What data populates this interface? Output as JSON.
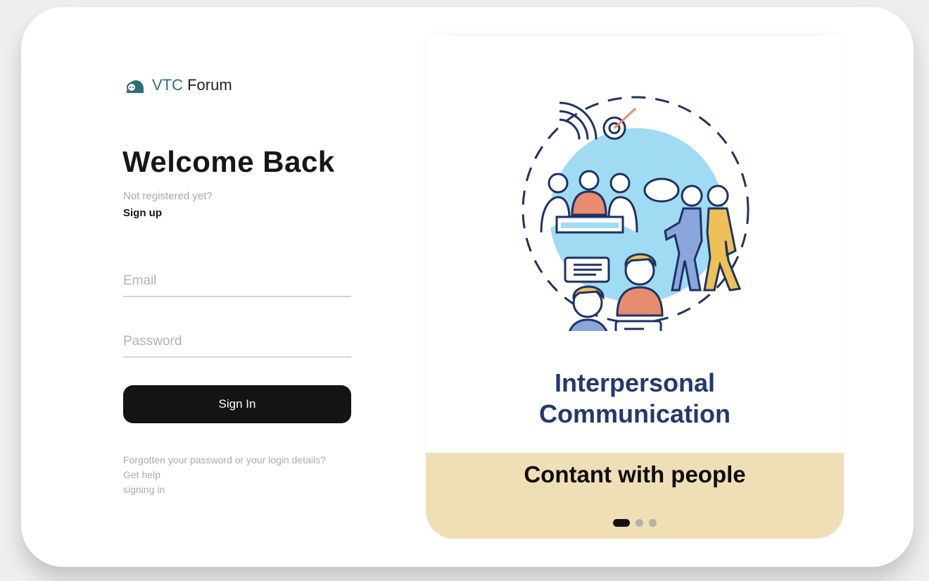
{
  "brand": {
    "name_accent": "VTC",
    "name_rest": " Forum",
    "icon": "chat-helmet-icon"
  },
  "login": {
    "heading": "Welcome Back",
    "not_registered": "Not registered yet?",
    "signup_label": "Sign up",
    "email_placeholder": "Email",
    "email_value": "",
    "password_placeholder": "Password",
    "password_value": "",
    "signin_label": "Sign In",
    "help_line1": "Forgotten your password or your login details?",
    "help_link": "Get help",
    "help_line3": "signing in"
  },
  "carousel": {
    "title_line1": "Interpersonal",
    "title_line2": "Communication",
    "caption": "Contant with people",
    "slide_count": 3,
    "active_slide": 1,
    "colors": {
      "band": "#f0dfb6",
      "title": "#22396e",
      "illustration_blue": "#9fdcf3",
      "illustration_orange": "#e98b6e",
      "illustration_yellow": "#edc156",
      "illustration_navy": "#1f3263"
    }
  },
  "colors": {
    "accent": "#2b6f78",
    "button": "#141414",
    "background": "#efefef"
  }
}
